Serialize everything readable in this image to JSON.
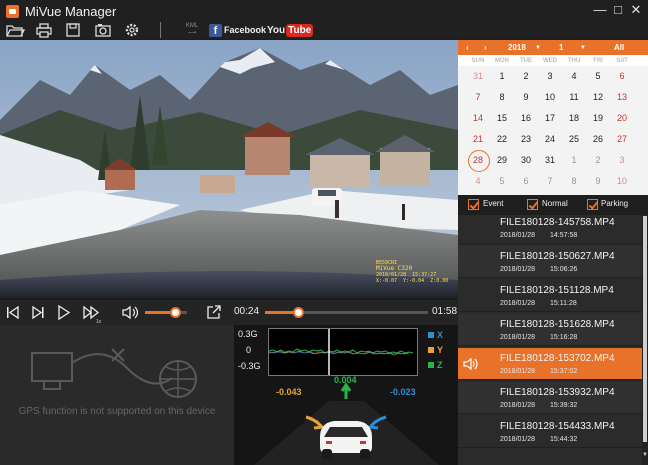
{
  "app": {
    "title": "MiVue Manager"
  },
  "window_controls": {
    "minimize": "—",
    "maximize": "□",
    "close": "✕"
  },
  "toolbar": {
    "kml_label": "KML",
    "facebook_label": "Facebook",
    "youtube_you": "You",
    "youtube_tube": "Tube",
    "icons": [
      "open-folder-icon",
      "print-icon",
      "save-icon",
      "snapshot-icon",
      "settings-icon",
      "kml-export-icon"
    ]
  },
  "video": {
    "osd_plate": "B559CRI",
    "osd_model": "MiVue C320",
    "osd_datetime": "2018/01/28  15:37:27",
    "osd_g": "X:-0.07  Y:-0.04  Z:0.00"
  },
  "playback": {
    "speed_label": "1x",
    "current_time": "00:24",
    "total_time": "01:58",
    "progress": 0.2,
    "volume": 0.72
  },
  "gps": {
    "message": "GPS function is not supported on this device"
  },
  "gsensor": {
    "y_labels": [
      "0.3G",
      "0",
      "-0.3G"
    ],
    "legend": [
      "X",
      "Y",
      "Z"
    ],
    "x_value": "-0.043",
    "y_value": "0.004",
    "z_value": "-0.023",
    "colors": {
      "x": "#2b8fd6",
      "y": "#e8a23a",
      "z": "#2bb24c"
    }
  },
  "calendar": {
    "year": "2018",
    "month": "1",
    "all_label": "All",
    "weekdays": [
      "SUN",
      "MON",
      "TUE",
      "WED",
      "THU",
      "FRI",
      "SAT"
    ],
    "weeks": [
      [
        "31",
        "1",
        "2",
        "3",
        "4",
        "5",
        "6"
      ],
      [
        "7",
        "8",
        "9",
        "10",
        "11",
        "12",
        "13"
      ],
      [
        "14",
        "15",
        "16",
        "17",
        "18",
        "19",
        "20"
      ],
      [
        "21",
        "22",
        "23",
        "24",
        "25",
        "26",
        "27"
      ],
      [
        "28",
        "29",
        "30",
        "31",
        "1",
        "2",
        "3"
      ],
      [
        "4",
        "5",
        "6",
        "7",
        "8",
        "9",
        "10"
      ]
    ],
    "selected_day": "28"
  },
  "filters": {
    "event": "Event",
    "normal": "Normal",
    "parking": "Parking"
  },
  "files": [
    {
      "name": "FILE180128-145758.MP4",
      "date": "2018/01/28",
      "time": "14:57:58"
    },
    {
      "name": "FILE180128-150627.MP4",
      "date": "2018/01/28",
      "time": "15:06:26"
    },
    {
      "name": "FILE180128-151128.MP4",
      "date": "2018/01/28",
      "time": "15:11:28"
    },
    {
      "name": "FILE180128-151628.MP4",
      "date": "2018/01/28",
      "time": "15:16:28"
    },
    {
      "name": "FILE180128-153702.MP4",
      "date": "2018/01/28",
      "time": "15:37:02"
    },
    {
      "name": "FILE180128-153932.MP4",
      "date": "2018/01/28",
      "time": "15:39:32"
    },
    {
      "name": "FILE180128-154433.MP4",
      "date": "2018/01/28",
      "time": "15:44:32"
    }
  ]
}
